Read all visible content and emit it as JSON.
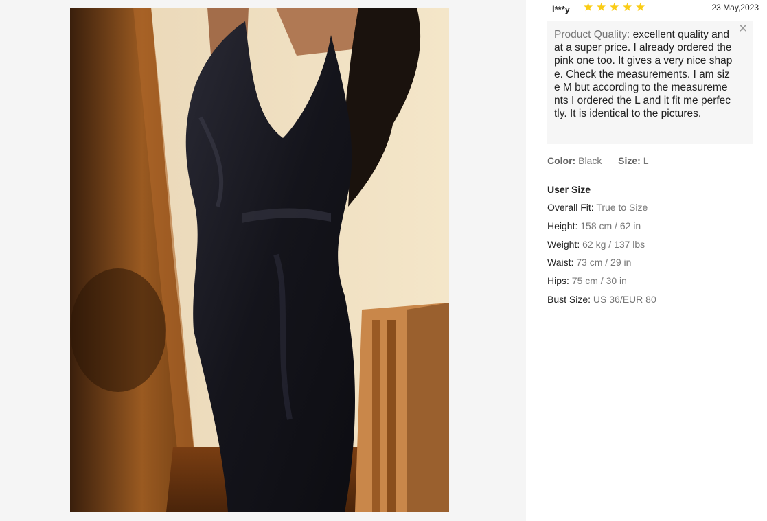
{
  "review": {
    "reviewer": "l***y",
    "rating": 5,
    "date": "23 May,2023",
    "comment_key": "Product Quality:",
    "comment_text": "excellent quality and at a super price. I already ordered the pink one too. It gives a very nice shape. Check the measurements. I am size M but according to the measurements I ordered the L and it fit me perfectly. It is identical to the pictures.",
    "color_label": "Color:",
    "color_value": "Black",
    "size_label": "Size:",
    "size_value": "L",
    "close_icon": "close-icon",
    "star_color": "#facc15"
  },
  "user_size": {
    "title": "User Size",
    "rows": [
      {
        "label": "Overall Fit:",
        "value": "True to Size"
      },
      {
        "label": "Height:",
        "value": "158 cm / 62 in"
      },
      {
        "label": "Weight:",
        "value": "62 kg / 137 lbs"
      },
      {
        "label": "Waist:",
        "value": "73 cm / 29 in"
      },
      {
        "label": "Hips:",
        "value": "75 cm / 30 in"
      },
      {
        "label": "Bust Size:",
        "value": "US 36/EUR 80"
      }
    ]
  }
}
